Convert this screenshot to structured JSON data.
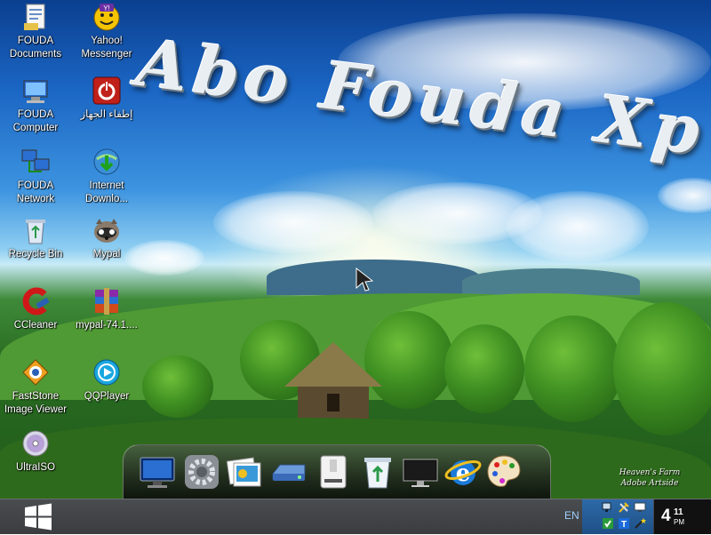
{
  "wallpaper": {
    "title_art": "Abo Fouda Xp",
    "credit_line1": "Heaven's Farm",
    "credit_line2": "Adobe Artside"
  },
  "desktop_icons": [
    {
      "label": "FOUDA Documents",
      "icon": "documents-icon"
    },
    {
      "label": "Yahoo! Messenger",
      "icon": "yahoo-messenger-icon"
    },
    {
      "label": "FOUDA Computer",
      "icon": "computer-icon"
    },
    {
      "label": "إطفاء الجهاز",
      "icon": "shutdown-icon"
    },
    {
      "label": "FOUDA Network",
      "icon": "network-icon"
    },
    {
      "label": "Internet Downlo...",
      "icon": "internet-download-manager-icon"
    },
    {
      "label": "Recycle Bin",
      "icon": "recycle-bin-icon"
    },
    {
      "label": "Mypal",
      "icon": "mypal-icon"
    },
    {
      "label": "CCleaner",
      "icon": "ccleaner-icon"
    },
    {
      "label": "mypal-74.1....",
      "icon": "winrar-archive-icon"
    },
    {
      "label": "FastStone Image Viewer",
      "icon": "faststone-icon"
    },
    {
      "label": "QQPlayer",
      "icon": "qqplayer-icon"
    },
    {
      "label": "UltraISO",
      "icon": "ultraiso-disc-icon"
    }
  ],
  "dock_items": [
    {
      "name": "monitor-icon"
    },
    {
      "name": "settings-gear-icon"
    },
    {
      "name": "photo-gallery-icon"
    },
    {
      "name": "hard-drive-icon"
    },
    {
      "name": "removable-drive-icon"
    },
    {
      "name": "recycle-bin-dock-icon"
    },
    {
      "name": "display-icon"
    },
    {
      "name": "internet-explorer-icon"
    },
    {
      "name": "paint-palette-icon"
    }
  ],
  "taskbar": {
    "start_icon": "windows-logo-icon",
    "language": "EN",
    "clock": {
      "hour": "4",
      "minute": "11",
      "ampm": "PM"
    }
  },
  "colors": {
    "taskbar": "#3a3c3f",
    "tray": "#1e4f86",
    "clock_bg": "#111111"
  }
}
